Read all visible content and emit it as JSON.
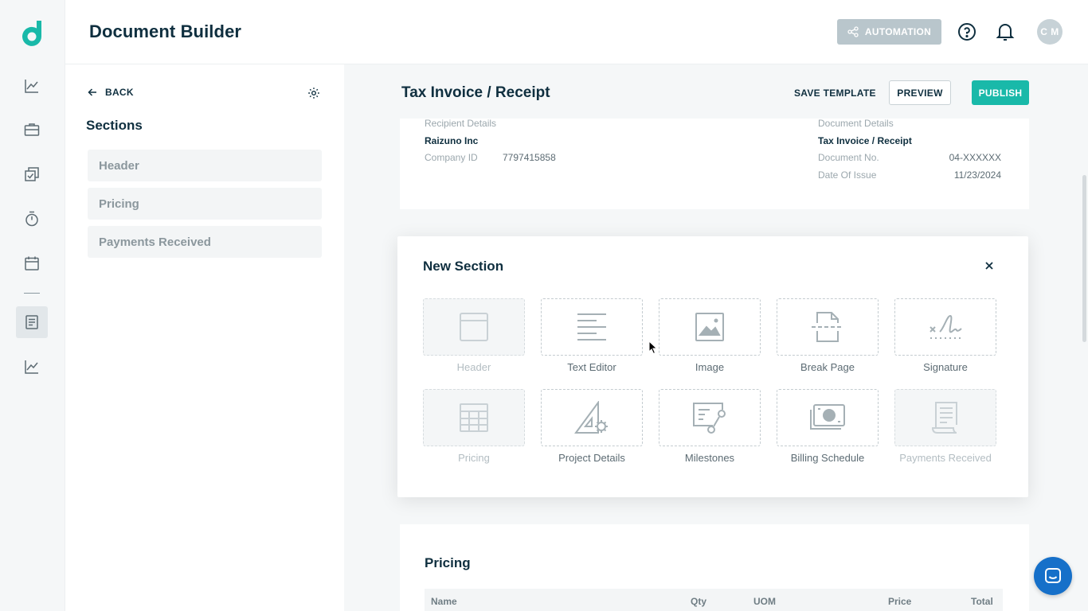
{
  "app": {
    "title": "Document Builder",
    "avatar_initials": "C M"
  },
  "header": {
    "automation_label": "AUTOMATION"
  },
  "rail": {
    "items": [
      {
        "name": "analytics-icon"
      },
      {
        "name": "briefcase-icon"
      },
      {
        "name": "tasks-icon"
      },
      {
        "name": "timer-icon"
      },
      {
        "name": "calendar-icon"
      },
      {
        "name": "document-icon",
        "active": true
      },
      {
        "name": "reports-icon"
      }
    ]
  },
  "sidebar": {
    "back_label": "BACK",
    "title": "Sections",
    "items": [
      {
        "label": "Header"
      },
      {
        "label": "Pricing"
      },
      {
        "label": "Payments Received"
      }
    ]
  },
  "main": {
    "doc_title": "Tax Invoice / Receipt",
    "save_template_label": "SAVE TEMPLATE",
    "preview_label": "PREVIEW",
    "publish_label": "PUBLISH"
  },
  "document": {
    "recipient_heading": "Recipient Details",
    "recipient_name": "Raizuno Inc",
    "company_id_label": "Company ID",
    "company_id_value": "7797415858",
    "doc_details_heading": "Document Details",
    "doc_details_title": "Tax Invoice / Receipt",
    "doc_no_label": "Document No.",
    "doc_no_value": "04-XXXXXX",
    "date_label": "Date Of Issue",
    "date_value": "11/23/2024"
  },
  "pricing": {
    "title": "Pricing",
    "columns": [
      "Name",
      "Qty",
      "UOM",
      "Price",
      "Total"
    ]
  },
  "modal": {
    "title": "New Section",
    "tiles": [
      {
        "label": "Header",
        "icon": "header-icon",
        "disabled": true
      },
      {
        "label": "Text Editor",
        "icon": "text-editor-icon",
        "disabled": false
      },
      {
        "label": "Image",
        "icon": "image-icon",
        "disabled": false
      },
      {
        "label": "Break Page",
        "icon": "break-page-icon",
        "disabled": false
      },
      {
        "label": "Signature",
        "icon": "signature-icon",
        "disabled": false
      },
      {
        "label": "Pricing",
        "icon": "pricing-table-icon",
        "disabled": true
      },
      {
        "label": "Project Details",
        "icon": "project-details-icon",
        "disabled": false
      },
      {
        "label": "Milestones",
        "icon": "milestones-icon",
        "disabled": false
      },
      {
        "label": "Billing Schedule",
        "icon": "billing-schedule-icon",
        "disabled": false
      },
      {
        "label": "Payments Received",
        "icon": "payments-received-icon",
        "disabled": true
      }
    ]
  },
  "colors": {
    "accent": "#19b9a9",
    "text_dark": "#0f2f3f",
    "automation_disabled": "#b9c6cc",
    "chat": "#1670c9"
  }
}
